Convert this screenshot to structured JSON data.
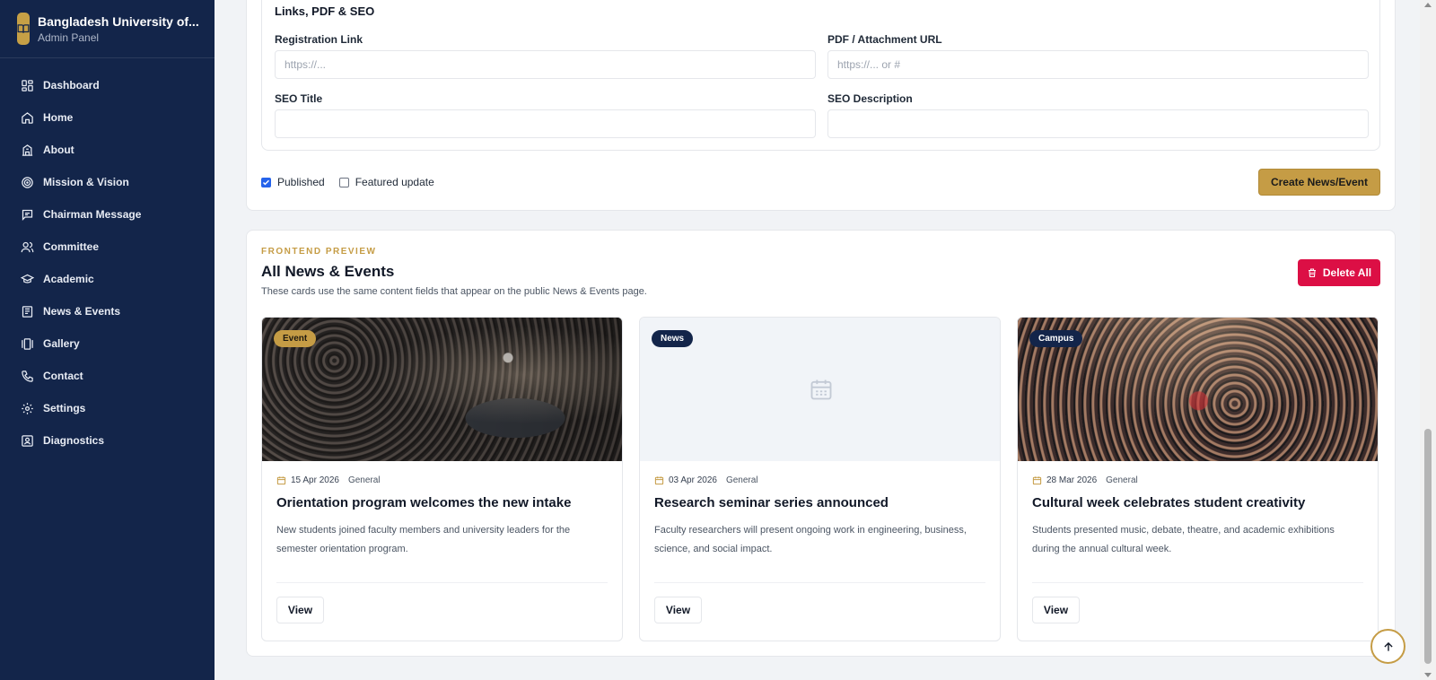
{
  "brand": {
    "title": "Bangladesh University of...",
    "subtitle": "Admin Panel"
  },
  "nav": {
    "items": [
      {
        "label": "Dashboard",
        "icon": "dashboard-icon"
      },
      {
        "label": "Home",
        "icon": "home-icon"
      },
      {
        "label": "About",
        "icon": "building-icon"
      },
      {
        "label": "Mission & Vision",
        "icon": "target-icon"
      },
      {
        "label": "Chairman Message",
        "icon": "message-icon"
      },
      {
        "label": "Committee",
        "icon": "users-icon"
      },
      {
        "label": "Academic",
        "icon": "graduation-cap-icon"
      },
      {
        "label": "News & Events",
        "icon": "newspaper-icon"
      },
      {
        "label": "Gallery",
        "icon": "gallery-icon"
      },
      {
        "label": "Contact",
        "icon": "phone-icon"
      },
      {
        "label": "Settings",
        "icon": "gear-icon"
      },
      {
        "label": "Diagnostics",
        "icon": "diagnostics-icon"
      }
    ]
  },
  "form": {
    "section_title": "Links, PDF & SEO",
    "registration_label": "Registration Link",
    "registration_placeholder": "https://...",
    "pdf_label": "PDF / Attachment URL",
    "pdf_placeholder": "https://... or #",
    "seo_title_label": "SEO Title",
    "seo_desc_label": "SEO Description",
    "published_label": "Published",
    "published_checked": true,
    "featured_label": "Featured update",
    "featured_checked": false,
    "create_label": "Create News/Event"
  },
  "preview": {
    "eyebrow": "FRONTEND PREVIEW",
    "title": "All News & Events",
    "subtitle": "These cards use the same content fields that appear on the public News & Events page.",
    "delete_label": "Delete All",
    "cards": [
      {
        "badge": "Event",
        "date": "15 Apr 2026",
        "category": "General",
        "title": "Orientation program welcomes the new intake",
        "desc": "New students joined faculty members and university leaders for the semester orientation program.",
        "view_label": "View"
      },
      {
        "badge": "News",
        "date": "03 Apr 2026",
        "category": "General",
        "title": "Research seminar series announced",
        "desc": "Faculty researchers will present ongoing work in engineering, business, science, and social impact.",
        "view_label": "View"
      },
      {
        "badge": "Campus",
        "date": "28 Mar 2026",
        "category": "General",
        "title": "Cultural week celebrates student creativity",
        "desc": "Students presented music, debate, theatre, and academic exhibitions during the annual cultural week.",
        "view_label": "View"
      }
    ]
  },
  "colors": {
    "sidebar": "#13254a",
    "accent": "#c59c45",
    "danger": "#dc0f45"
  }
}
